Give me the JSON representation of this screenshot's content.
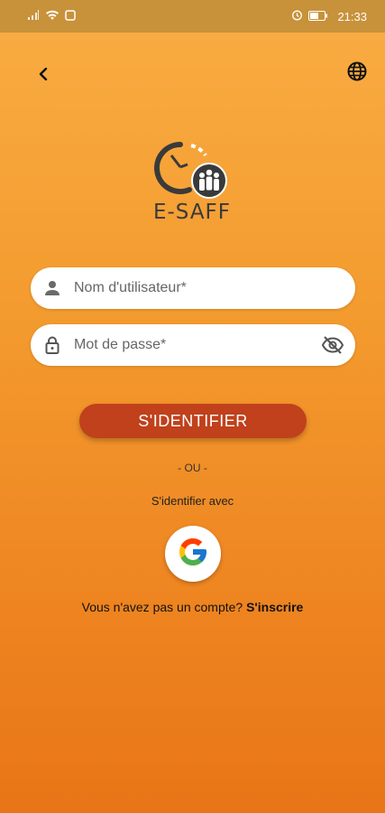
{
  "status_bar": {
    "time": "21:33"
  },
  "icons": {
    "back": "back-arrow-icon",
    "language": "globe-icon",
    "user": "user-icon",
    "lock": "lock-icon",
    "visibility": "eye-off-icon",
    "google": "google-icon"
  },
  "logo": {
    "text": "E-SAFF"
  },
  "form": {
    "username_placeholder": "Nom d'utilisateur*",
    "password_placeholder": "Mot de passe*",
    "login_label": "S'IDENTIFIER"
  },
  "alt_login": {
    "or_text": "- OU -",
    "with_text": "S'identifier avec"
  },
  "signup": {
    "prompt": "Vous n'avez pas un compte?",
    "link": "S'inscrire"
  },
  "colors": {
    "background_top": "#f9ad43",
    "background_bottom": "#e87517",
    "button": "#c0411c"
  }
}
